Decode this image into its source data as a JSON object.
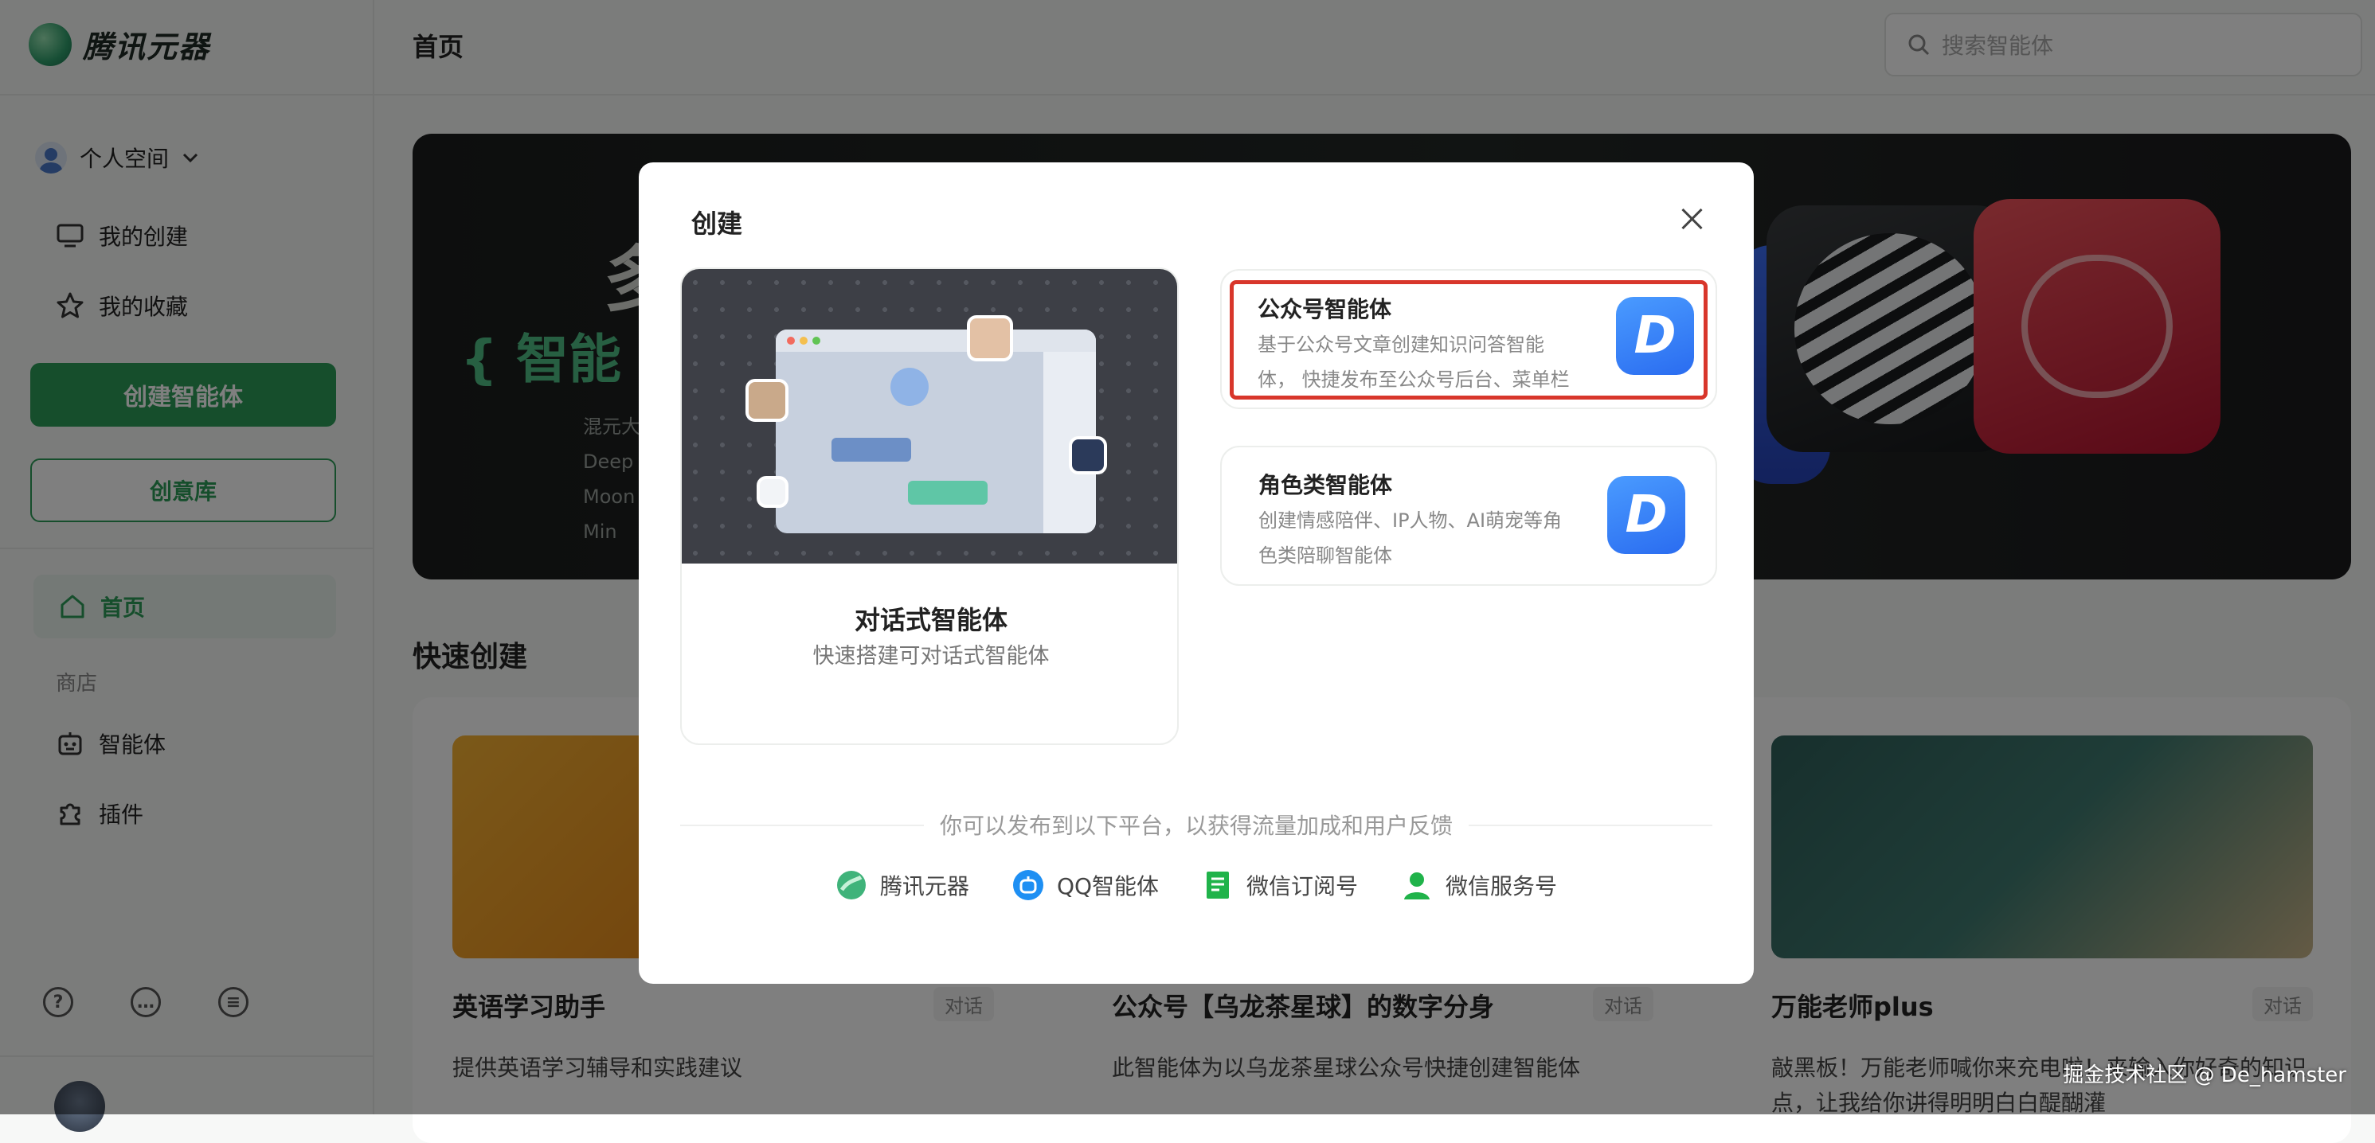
{
  "app": {
    "name": "腾讯元器"
  },
  "sidebar": {
    "space": "个人空间",
    "items": [
      {
        "label": "我的创建"
      },
      {
        "label": "我的收藏"
      }
    ],
    "create_button": "创建智能体",
    "idea_button": "创意库",
    "home": "首页",
    "store_section": "商店",
    "store_items": [
      {
        "label": "智能体"
      },
      {
        "label": "插件"
      }
    ]
  },
  "header": {
    "title": "首页",
    "search_placeholder": "搜索智能体"
  },
  "banner": {
    "big_char": "多",
    "subtitle": "{ 智能",
    "lines": [
      "混元大",
      "Deep",
      "Moon",
      "Min"
    ]
  },
  "quick_create": {
    "title": "快速创建",
    "cards": [
      {
        "name": "英语学习助手",
        "tag": "对话",
        "desc": "提供英语学习辅导和实践建议"
      },
      {
        "name": "公众号【乌龙茶星球】的数字分身",
        "tag": "对话",
        "desc": "此智能体为以乌龙茶星球公众号快捷创建智能体"
      },
      {
        "name": "万能老师plus",
        "tag": "对话",
        "desc": "敲黑板！万能老师喊你来充电啦！来输入你好奇的知识点，让我给你讲得明明白白醍醐灌"
      }
    ]
  },
  "modal": {
    "title": "创建",
    "chat_card": {
      "name": "对话式智能体",
      "desc": "快速搭建可对话式智能体"
    },
    "options": [
      {
        "name": "公众号智能体",
        "desc": "基于公众号文章创建知识问答智能体， 快捷发布至公众号后台、菜单栏",
        "logo": "D"
      },
      {
        "name": "角色类智能体",
        "desc": "创建情感陪伴、IP人物、AI萌宠等角色类陪聊智能体",
        "logo": "D"
      }
    ],
    "publish_hint": "你可以发布到以下平台，以获得流量加成和用户反馈",
    "platforms": [
      {
        "label": "腾讯元器",
        "icon": "yuanqi-icon"
      },
      {
        "label": "QQ智能体",
        "icon": "qq-bot-icon"
      },
      {
        "label": "微信订阅号",
        "icon": "wechat-subscription-icon"
      },
      {
        "label": "微信服务号",
        "icon": "wechat-service-icon"
      }
    ]
  },
  "watermark": "掘金技术社区 @ De_hamster",
  "colors": {
    "brand_green": "#2c9d58",
    "highlight_red": "#d8362b",
    "logo_blue": "#2a6cf0"
  }
}
